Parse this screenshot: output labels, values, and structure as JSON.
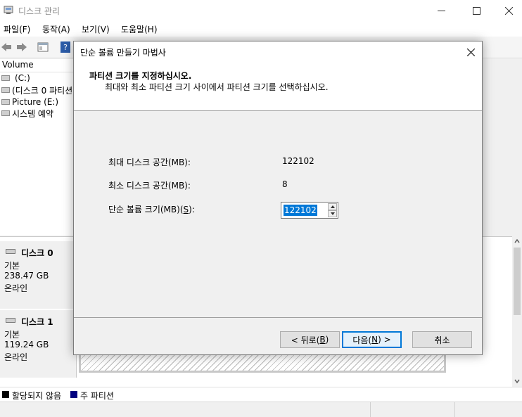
{
  "window": {
    "title": "디스크 관리",
    "menu": [
      "파일(F)",
      "동작(A)",
      "보기(V)",
      "도움말(H)"
    ],
    "volume_header": "Volume",
    "volumes": [
      "(C:)",
      "(디스크 0 파티션",
      "Picture (E:)",
      "시스템 예약"
    ],
    "disks": [
      {
        "name": "디스크 0",
        "type": "기본",
        "size": "238.47 GB",
        "status": "온라인"
      },
      {
        "name": "디스크 1",
        "type": "기본",
        "size": "119.24 GB",
        "status": "온라인"
      }
    ],
    "legend": [
      {
        "label": "할당되지 않음",
        "color": "#000000"
      },
      {
        "label": "주 파티션",
        "color": "#00007f"
      }
    ]
  },
  "dialog": {
    "title": "단순 볼륨 만들기 마법사",
    "heading": "파티션 크기를 지정하십시오.",
    "subheading": "최대와 최소 파티션 크기 사이에서 파티션 크기를 선택하십시오.",
    "max_label": "최대 디스크 공간(MB):",
    "max_value": "122102",
    "min_label": "최소 디스크 공간(MB):",
    "min_value": "8",
    "size_label_main": "단순 볼륨 크기(MB)(",
    "size_label_key": "S",
    "size_label_end": "):",
    "size_value": "122102",
    "back_main": "< 뒤로(",
    "back_key": "B",
    "back_end": ")",
    "next_main": "다음(",
    "next_key": "N",
    "next_end": ") >",
    "cancel": "취소"
  }
}
